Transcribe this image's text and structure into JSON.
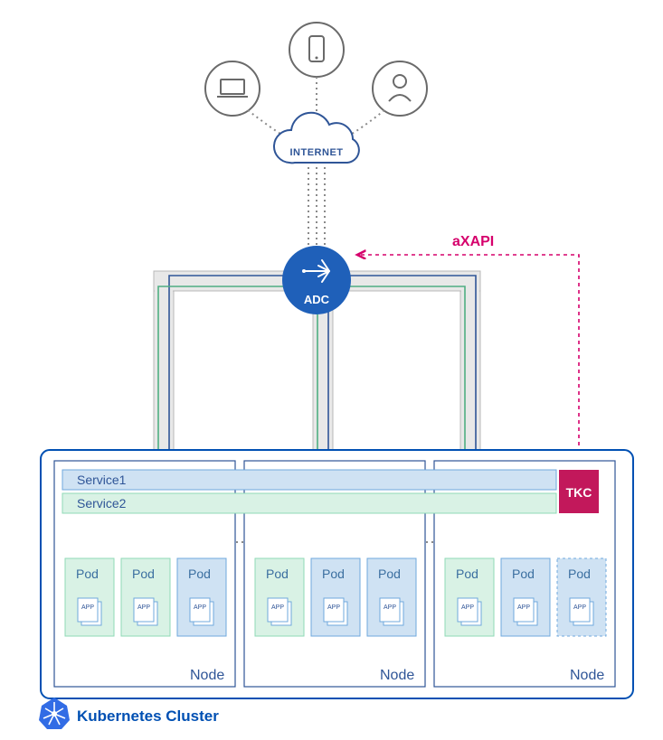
{
  "clients": {
    "left_icon": "laptop-icon",
    "center_icon": "phone-icon",
    "right_icon": "user-icon"
  },
  "internet_label": "INTERNET",
  "axapi_label": "aXAPI",
  "adc_label": "ADC",
  "tkc_label": "TKC",
  "cluster_label": "Kubernetes Cluster",
  "services": {
    "s1": "Service1",
    "s2": "Service2"
  },
  "pod_label": "Pod",
  "app_label": "APP",
  "node_label": "Node",
  "nodes": [
    {
      "pods": [
        {
          "label_key": "pod_label",
          "color": "green"
        },
        {
          "label_key": "pod_label",
          "color": "green"
        },
        {
          "label_key": "pod_label",
          "color": "blue"
        }
      ]
    },
    {
      "pods": [
        {
          "label_key": "pod_label",
          "color": "green"
        },
        {
          "label_key": "pod_label",
          "color": "blue"
        },
        {
          "label_key": "pod_label",
          "color": "blue"
        }
      ]
    },
    {
      "pods": [
        {
          "label_key": "pod_label",
          "color": "green"
        },
        {
          "label_key": "pod_label",
          "color": "blue"
        },
        {
          "label_key": "pod_label",
          "color": "blue-dashed"
        }
      ]
    }
  ]
}
